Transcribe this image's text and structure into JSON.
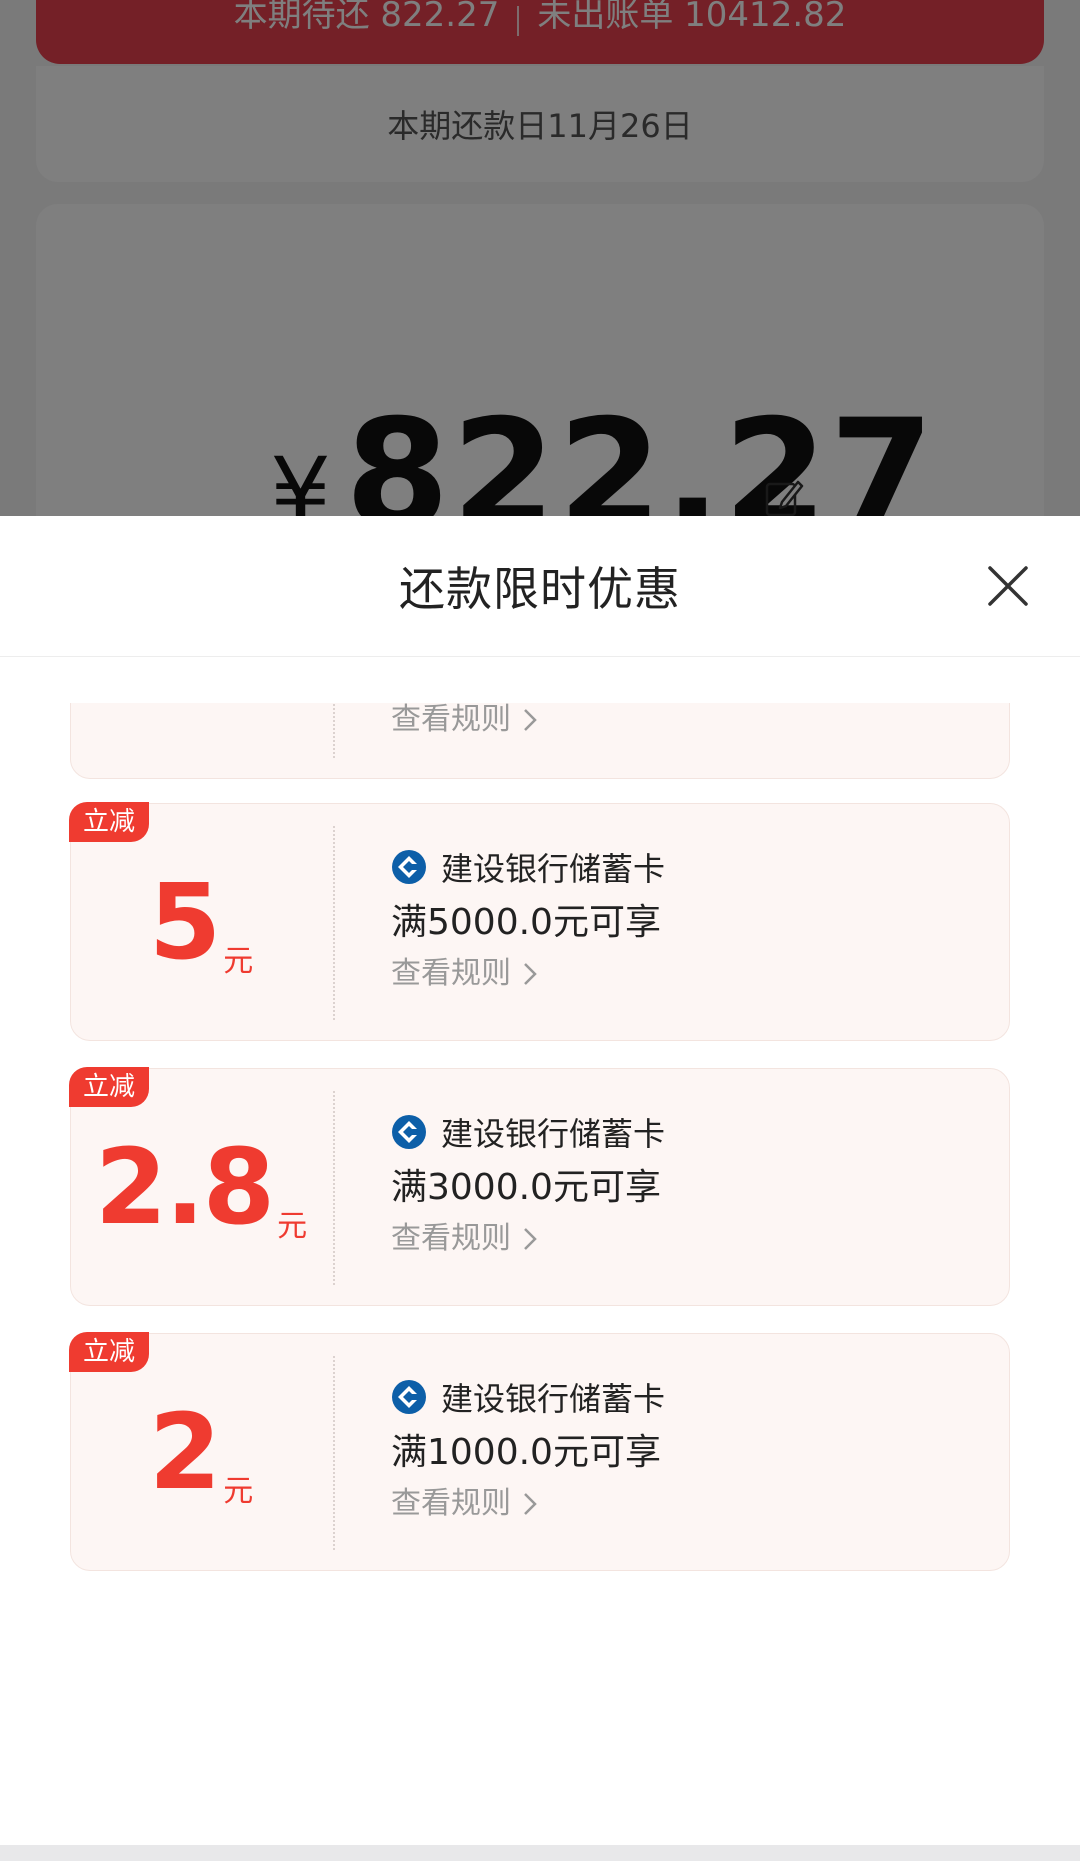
{
  "background": {
    "banner": {
      "pending_label": "本期待还 822.27",
      "unbilled_label": "未出账单 10412.82"
    },
    "due_date": "本期还款日11月26日",
    "amount": {
      "currency": "¥",
      "value": "822.27"
    }
  },
  "sheet": {
    "title": "还款限时优惠",
    "coupons": [
      {
        "tag": "",
        "amount": "",
        "unit": "",
        "bank": "",
        "condition": "",
        "rule_link": "查看规则"
      },
      {
        "tag": "立减",
        "amount": "5",
        "unit": "元",
        "bank": "建设银行储蓄卡",
        "condition": "满5000.0元可享",
        "rule_link": "查看规则"
      },
      {
        "tag": "立减",
        "amount": "2.8",
        "unit": "元",
        "bank": "建设银行储蓄卡",
        "condition": "满3000.0元可享",
        "rule_link": "查看规则"
      },
      {
        "tag": "立减",
        "amount": "2",
        "unit": "元",
        "bank": "建设银行储蓄卡",
        "condition": "满1000.0元可享",
        "rule_link": "查看规则"
      }
    ]
  },
  "colors": {
    "accent_red": "#ef3b30",
    "banner_red": "#e8404e",
    "bank_blue": "#0d5fa8",
    "coupon_bg": "#fdf6f4"
  },
  "icons": {
    "close": "close-icon",
    "bank_logo": "ccb-logo-icon",
    "chevron": "chevron-right-icon",
    "edit": "edit-icon"
  }
}
